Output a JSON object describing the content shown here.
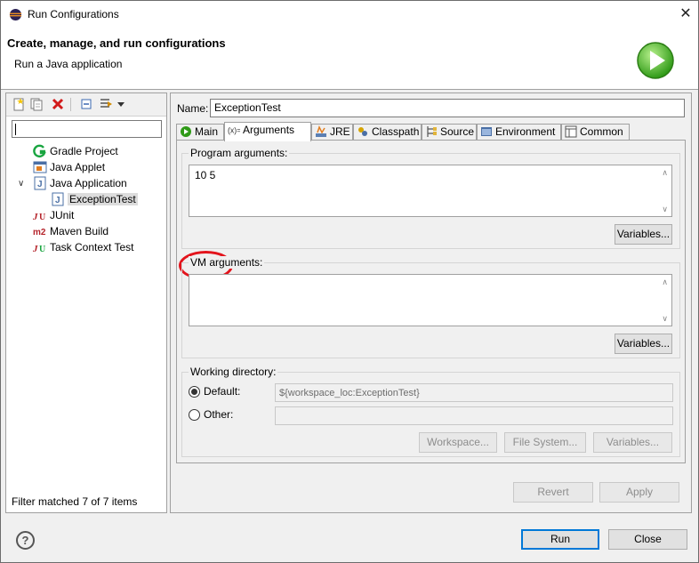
{
  "window": {
    "title": "Run Configurations",
    "close_glyph": "✕"
  },
  "banner": {
    "title": "Create, manage, and run configurations",
    "subtitle": "Run a Java application"
  },
  "left": {
    "filter_value": "",
    "tree": [
      {
        "label": "Gradle Project",
        "icon": "gradle-icon"
      },
      {
        "label": "Java Applet",
        "icon": "java-applet-icon"
      },
      {
        "label": "Java Application",
        "icon": "java-application-icon",
        "expanded": true
      },
      {
        "label": "ExceptionTest",
        "icon": "java-class-icon",
        "selected": true
      },
      {
        "label": "JUnit",
        "icon": "junit-icon"
      },
      {
        "label": "Maven Build",
        "icon": "maven-icon"
      },
      {
        "label": "Task Context Test",
        "icon": "task-context-icon"
      }
    ],
    "status": "Filter matched 7 of 7 items"
  },
  "right": {
    "name_label": "Name:",
    "name_value": "ExceptionTest",
    "tabs": [
      {
        "label": "Main",
        "icon": "main-tab-icon"
      },
      {
        "label": "Arguments",
        "icon": "arguments-tab-icon",
        "active": true
      },
      {
        "label": "JRE",
        "icon": "jre-tab-icon"
      },
      {
        "label": "Classpath",
        "icon": "classpath-tab-icon"
      },
      {
        "label": "Source",
        "icon": "source-tab-icon"
      },
      {
        "label": "Environment",
        "icon": "environment-tab-icon"
      },
      {
        "label": "Common",
        "icon": "common-tab-icon"
      }
    ],
    "program_args": {
      "label": "Program arguments:",
      "value": "10 5",
      "variables": "Variables..."
    },
    "vm_args": {
      "label": "VM arguments:",
      "value": "",
      "variables": "Variables..."
    },
    "working_dir": {
      "label": "Working directory:",
      "default_label": "Default:",
      "default_value": "${workspace_loc:ExceptionTest}",
      "other_label": "Other:",
      "other_value": "",
      "workspace_btn": "Workspace...",
      "filesystem_btn": "File System...",
      "variables_btn": "Variables..."
    },
    "revert": "Revert",
    "apply": "Apply"
  },
  "footer": {
    "help": "?",
    "run": "Run",
    "close": "Close"
  },
  "colors": {
    "annotation": "#e3141c",
    "accent": "#0078d7"
  }
}
